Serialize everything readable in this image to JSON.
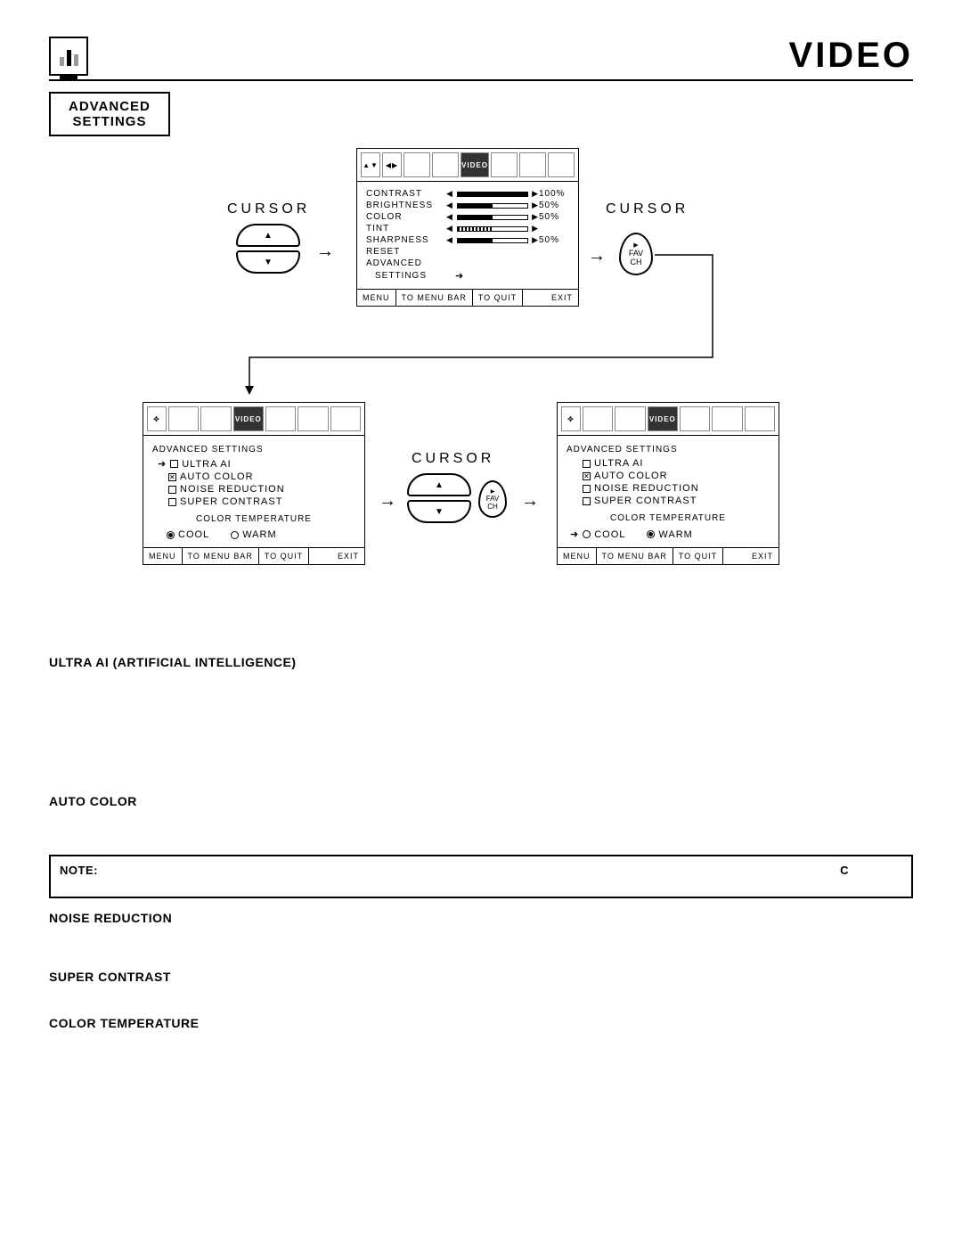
{
  "header": {
    "title": "VIDEO"
  },
  "advanced_box": {
    "line1": "ADVANCED",
    "line2": "SETTINGS"
  },
  "cursor_label": "CURSOR",
  "fav_btn": {
    "line1": "FAV",
    "line2": "CH"
  },
  "osd_main": {
    "selected_tab": "VIDEO",
    "rows": [
      {
        "label": "CONTRAST",
        "value": 100,
        "text": "100%"
      },
      {
        "label": "BRIGHTNESS",
        "value": 50,
        "text": "50%"
      },
      {
        "label": "COLOR",
        "value": 50,
        "text": "50%"
      },
      {
        "label": "TINT",
        "value": 50,
        "text": ""
      },
      {
        "label": "SHARPNESS",
        "value": 50,
        "text": "50%"
      }
    ],
    "extra": [
      "RESET",
      "ADVANCED",
      "SETTINGS"
    ],
    "footer": {
      "menu": "MENU",
      "to_bar": "TO MENU BAR",
      "to_quit": "TO QUIT",
      "exit": "EXIT"
    }
  },
  "osd_adv": {
    "title": "ADVANCED SETTINGS",
    "items": [
      {
        "label": "ULTRA AI",
        "checked": false
      },
      {
        "label": "AUTO COLOR",
        "checked": true
      },
      {
        "label": "NOISE  REDUCTION",
        "checked": false
      },
      {
        "label": "SUPER CONTRAST",
        "checked": false
      }
    ],
    "temp_label": "COLOR TEMPERATURE",
    "temp_left": {
      "cool": "COOL",
      "warm": "WARM",
      "cool_sel": true
    },
    "temp_right": {
      "cool": "COOL",
      "warm": "WARM",
      "cool_sel": false
    },
    "footer": {
      "menu": "MENU",
      "to_bar": "TO MENU BAR",
      "to_quit": "TO QUIT",
      "exit": "EXIT"
    }
  },
  "sections": {
    "ultra_ai": "ULTRA AI (ARTIFICIAL INTELLIGENCE)",
    "auto_color": "AUTO COLOR",
    "note_label": "NOTE:",
    "note_c": "C",
    "noise": "NOISE REDUCTION",
    "super": "SUPER CONTRAST",
    "color_temp": "COLOR TEMPERATURE"
  }
}
